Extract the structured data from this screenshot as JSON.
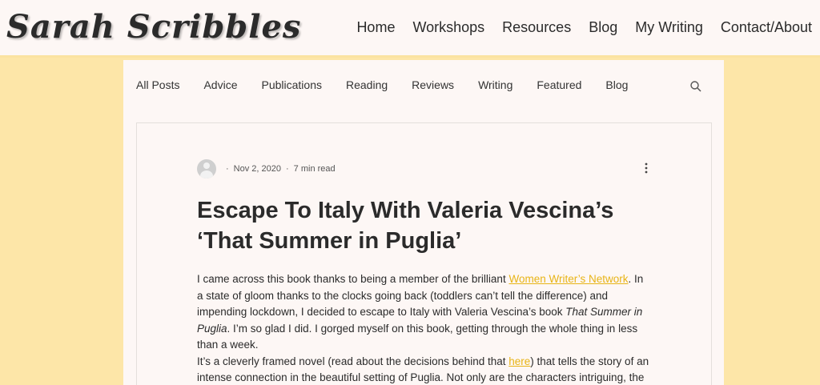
{
  "header": {
    "logo": "Sarah Scribbles",
    "nav": [
      "Home",
      "Workshops",
      "Resources",
      "Blog",
      "My Writing",
      "Contact/About"
    ]
  },
  "categories": [
    "All Posts",
    "Advice",
    "Publications",
    "Reading",
    "Reviews",
    "Writing",
    "Featured",
    "Blog"
  ],
  "post": {
    "date": "Nov 2, 2020",
    "read_time": "7 min read",
    "title": "Escape To Italy With Valeria Vescina’s ‘That Summer in Puglia’",
    "p1_a": "I came across this book thanks to being a member of the brilliant ",
    "p1_link": "Women Writer’s Network",
    "p1_b": ". In a state of gloom thanks to the clocks going back (toddlers can’t tell the difference) and impending lockdown, I decided to escape to Italy with Valeria Vescina’s book ",
    "p1_em": "That Summer in Puglia",
    "p1_c": ". I’m so glad I did. I gorged myself on this book, getting through the whole thing in less than a week.",
    "p2_a": "It’s a cleverly framed novel (read about the decisions behind that ",
    "p2_link": "here",
    "p2_b": ") that tells the story of an intense connection in the beautiful setting of Puglia. Not only are the characters intriguing, the"
  },
  "colors": {
    "background": "#fde6a8",
    "panel": "#fdf7f5",
    "link": "#e8b416"
  }
}
